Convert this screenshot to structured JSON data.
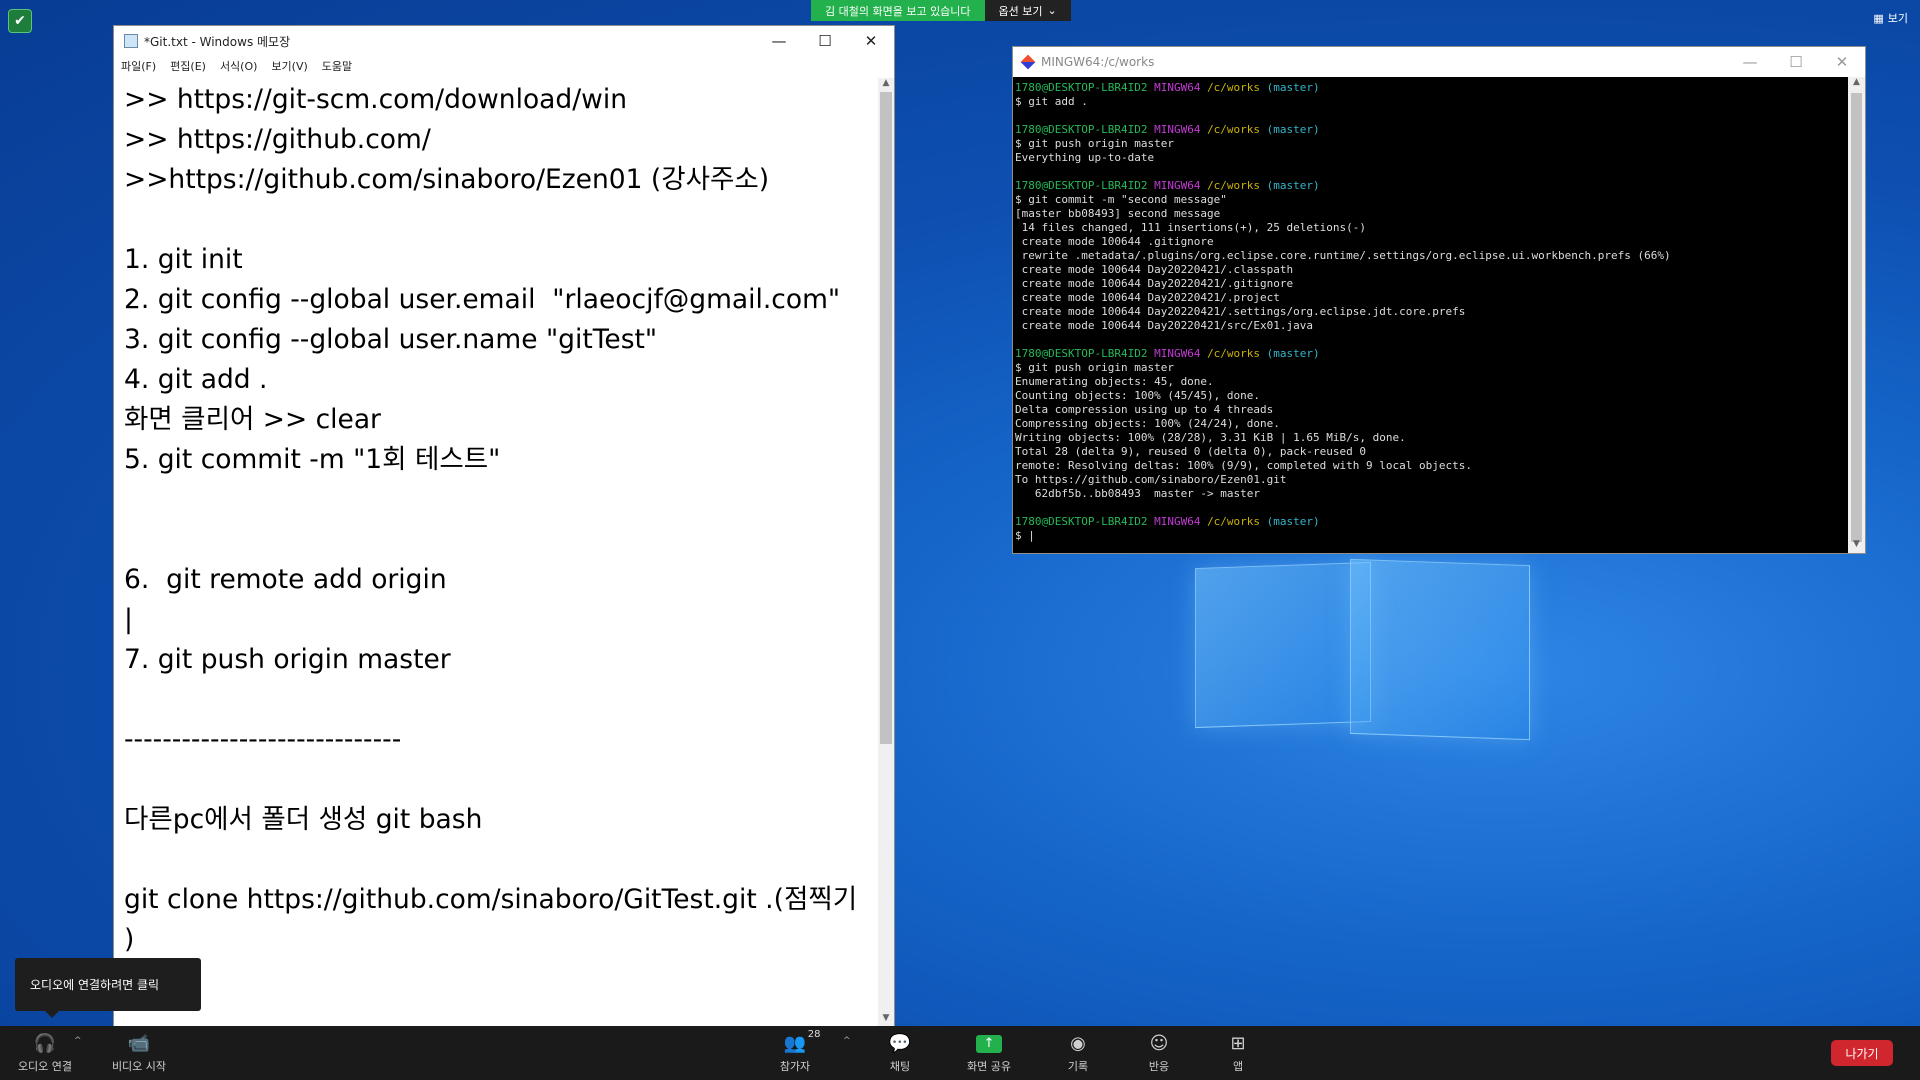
{
  "desktop": {
    "share_banner": {
      "message": "김 대철의 화면을 보고 있습니다",
      "options_label": "옵션 보기"
    },
    "view_label": "보기"
  },
  "notepad": {
    "title": "*Git.txt - Windows 메모장",
    "menu": [
      "파일(F)",
      "편집(E)",
      "서식(O)",
      "보기(V)",
      "도움말"
    ],
    "lines": [
      ">> https://git-scm.com/download/win",
      ">> https://github.com/",
      ">>https://github.com/sinaboro/Ezen01 (강사주소)",
      "",
      "1. git init",
      "2. git config --global user.email  \"rlaeocjf@gmail.com\"",
      "3. git config --global user.name \"gitTest\"",
      "4. git add .",
      "화면 클리어 >> clear",
      "5. git commit -m \"1회 테스트\"",
      "",
      "",
      "6.  git remote add origin",
      "|",
      "7. git push origin master",
      "",
      "-----------------------------",
      "",
      "다른pc에서 폴더 생성 git bash",
      "",
      "git clone https://github.com/sinaboro/GitTest.git .(점찍기",
      ")"
    ]
  },
  "terminal": {
    "title": "MINGW64:/c/works",
    "prompt": {
      "user": "1780@DESKTOP-LBR4ID2",
      "env": "MINGW64",
      "path": "/c/works",
      "branch": "(master)"
    },
    "blocks": [
      {
        "cmd": "$ git add .",
        "output": []
      },
      {
        "cmd": "$ git push origin master",
        "output": [
          "Everything up-to-date"
        ]
      },
      {
        "cmd": "$ git commit -m \"second message\"",
        "output": [
          "[master bb08493] second message",
          " 14 files changed, 111 insertions(+), 25 deletions(-)",
          " create mode 100644 .gitignore",
          " rewrite .metadata/.plugins/org.eclipse.core.runtime/.settings/org.eclipse.ui.workbench.prefs (66%)",
          " create mode 100644 Day20220421/.classpath",
          " create mode 100644 Day20220421/.gitignore",
          " create mode 100644 Day20220421/.project",
          " create mode 100644 Day20220421/.settings/org.eclipse.jdt.core.prefs",
          " create mode 100644 Day20220421/src/Ex01.java"
        ]
      },
      {
        "cmd": "$ git push origin master",
        "output": [
          "Enumerating objects: 45, done.",
          "Counting objects: 100% (45/45), done.",
          "Delta compression using up to 4 threads",
          "Compressing objects: 100% (24/24), done.",
          "Writing objects: 100% (28/28), 3.31 KiB | 1.65 MiB/s, done.",
          "Total 28 (delta 9), reused 0 (delta 0), pack-reused 0",
          "remote: Resolving deltas: 100% (9/9), completed with 9 local objects.",
          "To https://github.com/sinaboro/Ezen01.git",
          "   62dbf5b..bb08493  master -> master"
        ]
      },
      {
        "cmd": "$ |",
        "output": []
      }
    ]
  },
  "tooltip": {
    "text": "오디오에 연결하려면 클릭"
  },
  "toolbar": {
    "audio": "오디오 연결",
    "video": "비디오 시작",
    "participants": "참가자",
    "participants_count": "28",
    "chat": "채팅",
    "share": "화면 공유",
    "record": "기록",
    "reactions": "반응",
    "apps": "앱",
    "leave": "나가기"
  },
  "colors": {
    "share_green": "#22b14c",
    "leave_red": "#d0262d",
    "toolbar_bg": "#1a1a1a"
  }
}
